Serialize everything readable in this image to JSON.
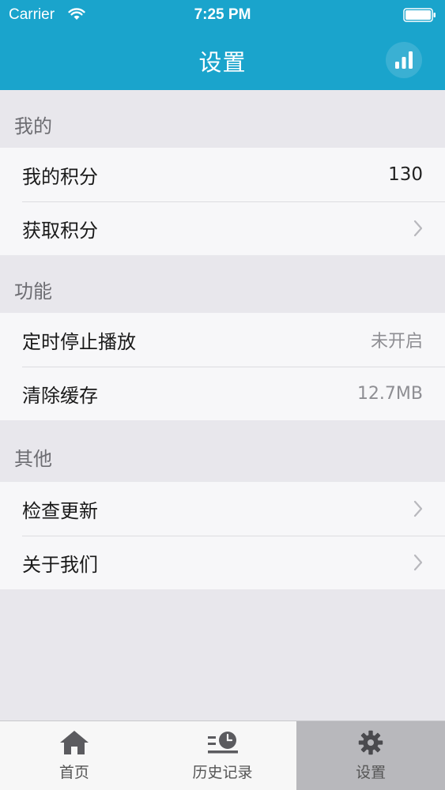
{
  "status_bar": {
    "carrier": "Carrier",
    "time": "7:25 PM"
  },
  "nav": {
    "title": "设置",
    "right_icon": "bar-chart-icon"
  },
  "sections": [
    {
      "title": "我的",
      "rows": [
        {
          "label": "我的积分",
          "value": "130",
          "accessory": "value"
        },
        {
          "label": "获取积分",
          "value": "",
          "accessory": "chevron"
        }
      ]
    },
    {
      "title": "功能",
      "rows": [
        {
          "label": "定时停止播放",
          "value": "未开启",
          "accessory": "value"
        },
        {
          "label": "清除缓存",
          "value": "12.7MB",
          "accessory": "value"
        }
      ]
    },
    {
      "title": "其他",
      "rows": [
        {
          "label": "检查更新",
          "value": "",
          "accessory": "chevron"
        },
        {
          "label": "关于我们",
          "value": "",
          "accessory": "chevron"
        }
      ]
    }
  ],
  "tab_bar": {
    "items": [
      {
        "label": "首页",
        "icon": "home-icon",
        "active": false
      },
      {
        "label": "历史记录",
        "icon": "history-icon",
        "active": false
      },
      {
        "label": "设置",
        "icon": "gear-icon",
        "active": true
      }
    ]
  },
  "colors": {
    "accent": "#1aa4cc",
    "background": "#e8e7ec",
    "tab_active": "#b8b8bc"
  }
}
